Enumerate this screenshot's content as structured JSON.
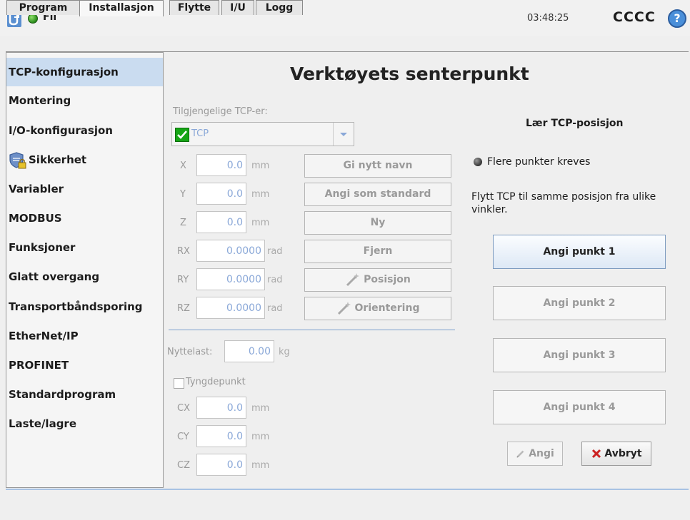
{
  "topbar": {
    "file_label": "Fil",
    "clock": "03:48:25",
    "robot_name": "CCCC",
    "help_glyph": "?"
  },
  "tabs": [
    "Program",
    "Installasjon",
    "Flytte",
    "I/U",
    "Logg"
  ],
  "sidebar": {
    "items": [
      "TCP-konfigurasjon",
      "Montering",
      "I/O-konfigurasjon",
      "Sikkerhet",
      "Variabler",
      "MODBUS",
      "Funksjoner",
      "Glatt overgang",
      "Transportbåndsporing",
      "EtherNet/IP",
      "PROFINET",
      "Standardprogram",
      "Laste/lagre"
    ]
  },
  "main": {
    "title": "Verktøyets senterpunkt",
    "available_label": "Tilgjengelige TCP-er:",
    "tcp_selected": "TCP",
    "fields": [
      {
        "label": "X",
        "value": "0.0",
        "unit": "mm"
      },
      {
        "label": "Y",
        "value": "0.0",
        "unit": "mm"
      },
      {
        "label": "Z",
        "value": "0.0",
        "unit": "mm"
      },
      {
        "label": "RX",
        "value": "0.0000",
        "unit": "rad"
      },
      {
        "label": "RY",
        "value": "0.0000",
        "unit": "rad"
      },
      {
        "label": "RZ",
        "value": "0.0000",
        "unit": "rad"
      }
    ],
    "buttons": {
      "rename": "Gi nytt navn",
      "set_default": "Angi som standard",
      "new": "Ny",
      "remove": "Fjern",
      "position": "Posisjon",
      "orientation": "Orientering"
    },
    "payload": {
      "label": "Nyttelast:",
      "value": "0.00",
      "unit": "kg"
    },
    "cog": {
      "label": "Tyngdepunkt",
      "fields": [
        {
          "label": "CX",
          "value": "0.0",
          "unit": "mm"
        },
        {
          "label": "CY",
          "value": "0.0",
          "unit": "mm"
        },
        {
          "label": "CZ",
          "value": "0.0",
          "unit": "mm"
        }
      ]
    },
    "teach": {
      "heading": "Lær TCP-posisjon",
      "status": "Flere punkter kreves",
      "instruction": "Flytt TCP til samme posisjon fra ulike vinkler.",
      "points": [
        "Angi punkt 1",
        "Angi punkt 2",
        "Angi punkt 3",
        "Angi punkt 4"
      ],
      "apply": "Angi",
      "cancel": "Avbryt"
    }
  },
  "colors": {
    "accent": "#cadcf0",
    "divider": "#7a9fcc",
    "status_ok": "#2a8b1b",
    "cancel_x": "#cc2222"
  }
}
